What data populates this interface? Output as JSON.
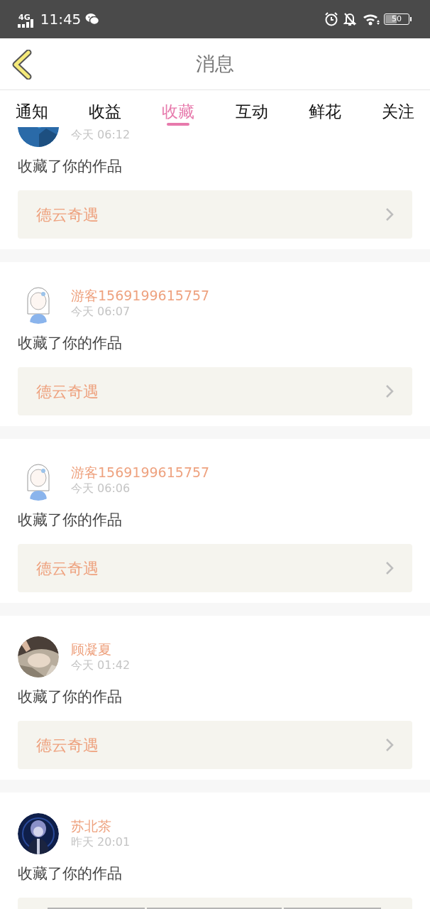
{
  "status_bar": {
    "network": "4G",
    "time": "11:45",
    "battery": "50"
  },
  "header": {
    "title": "消息"
  },
  "tabs": [
    {
      "label": "通知",
      "selected": false
    },
    {
      "label": "收益",
      "selected": false
    },
    {
      "label": "收藏",
      "selected": true
    },
    {
      "label": "互动",
      "selected": false
    },
    {
      "label": "鲜花",
      "selected": false
    },
    {
      "label": "关注",
      "selected": false
    }
  ],
  "messages": [
    {
      "time": "今天 06:12",
      "text": "收藏了你的作品",
      "work_title": "德云奇遇"
    },
    {
      "name": "游客1569199615757",
      "time": "今天 06:07",
      "text": "收藏了你的作品",
      "work_title": "德云奇遇"
    },
    {
      "name": "游客1569199615757",
      "time": "今天 06:06",
      "text": "收藏了你的作品",
      "work_title": "德云奇遇"
    },
    {
      "name": "顾凝夏",
      "time": "今天 01:42",
      "text": "收藏了你的作品",
      "work_title": "德云奇遇"
    },
    {
      "name": "苏北茶",
      "time": "昨天 20:01",
      "text": "收藏了你的作品",
      "work_loading": true
    }
  ]
}
